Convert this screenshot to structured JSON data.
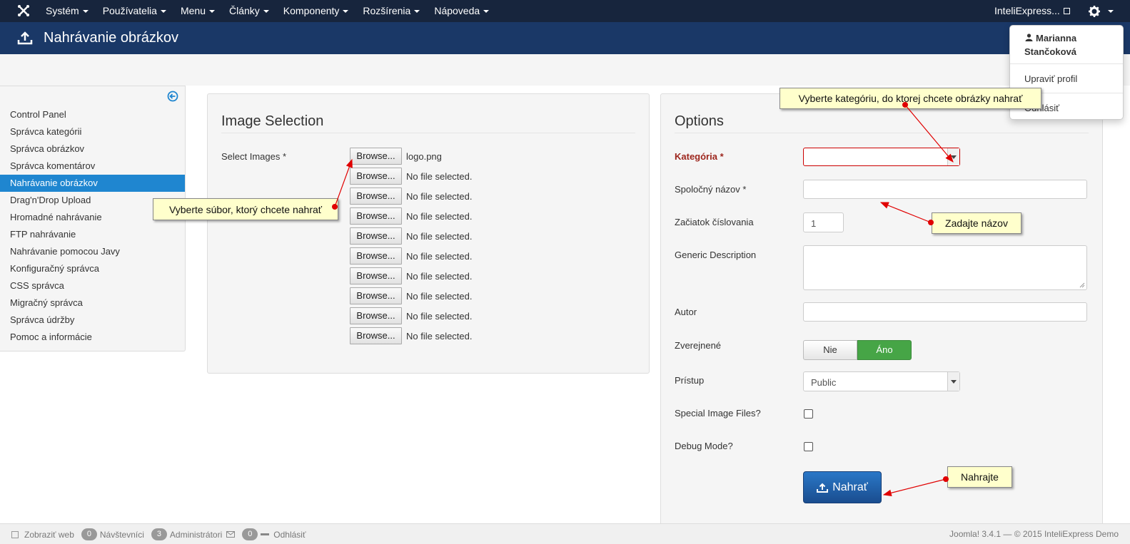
{
  "topnav": {
    "menu": [
      "Systém",
      "Používatelia",
      "Menu",
      "Články",
      "Komponenty",
      "Rozšírenia",
      "Nápoveda"
    ],
    "site_name": "InteliExpress...",
    "icons": {
      "logo": "joomla-logo-icon",
      "external": "external-link-icon",
      "settings": "gear-icon"
    }
  },
  "titlebar": {
    "title": "Nahrávanie obrázkov",
    "icon": "upload-icon"
  },
  "user_menu": {
    "user_name": "Marianna Stančoková",
    "edit_profile": "Upraviť profil",
    "logout": "Odhlásiť"
  },
  "sidebar": {
    "items": [
      {
        "label": "Control Panel",
        "active": false
      },
      {
        "label": "Správca kategórii",
        "active": false
      },
      {
        "label": "Správca obrázkov",
        "active": false
      },
      {
        "label": "Správca komentárov",
        "active": false
      },
      {
        "label": "Nahrávanie obrázkov",
        "active": true
      },
      {
        "label": "Drag'n'Drop Upload",
        "active": false
      },
      {
        "label": "Hromadné nahrávanie",
        "active": false
      },
      {
        "label": "FTP nahrávanie",
        "active": false
      },
      {
        "label": "Nahrávanie pomocou Javy",
        "active": false
      },
      {
        "label": "Konfiguračný správca",
        "active": false
      },
      {
        "label": "CSS správca",
        "active": false
      },
      {
        "label": "Migračný správca",
        "active": false
      },
      {
        "label": "Správca údržby",
        "active": false
      },
      {
        "label": "Pomoc a informácie",
        "active": false
      }
    ]
  },
  "image_selection": {
    "title": "Image Selection",
    "label": "Select Images *",
    "browse_label": "Browse...",
    "files": [
      "logo.png",
      "No file selected.",
      "No file selected.",
      "No file selected.",
      "No file selected.",
      "No file selected.",
      "No file selected.",
      "No file selected.",
      "No file selected.",
      "No file selected."
    ]
  },
  "options": {
    "title": "Options",
    "category_label": "Kategória *",
    "category_value": "",
    "common_name_label": "Spoločný názov *",
    "common_name_value": "",
    "numbering_label": "Začiatok číslovania",
    "numbering_value": "1",
    "description_label": "Generic Description",
    "description_value": "",
    "author_label": "Autor",
    "author_value": "",
    "published_label": "Zverejnené",
    "published_no": "Nie",
    "published_yes": "Áno",
    "published_selected": "Áno",
    "access_label": "Prístup",
    "access_value": "Public",
    "special_label": "Special Image Files?",
    "special_checked": false,
    "debug_label": "Debug Mode?",
    "debug_checked": false,
    "upload_button": "Nahrať"
  },
  "callouts": {
    "file": "Vyberte súbor, ktorý chcete nahrať",
    "category": "Vyberte kategóriu, do ktorej chcete obrázky nahrať",
    "name": "Zadajte názov",
    "upload": "Nahrajte"
  },
  "footer": {
    "view_site": "Zobraziť web",
    "visitors_count": "0",
    "visitors_label": "Návštevníci",
    "admins_count": "3",
    "admins_label": "Administrátori",
    "messages_count": "0",
    "logout": "Odhlásiť",
    "version": "Joomla! 3.4.1 — © 2015 InteliExpress Demo"
  },
  "colors": {
    "navbar": "#17253d",
    "titlebar": "#1a3867",
    "active_item": "#1f86d0",
    "required": "#9d261d",
    "toggle_yes": "#46a546",
    "callout": "#ffffcc",
    "arrow": "#e00000"
  }
}
